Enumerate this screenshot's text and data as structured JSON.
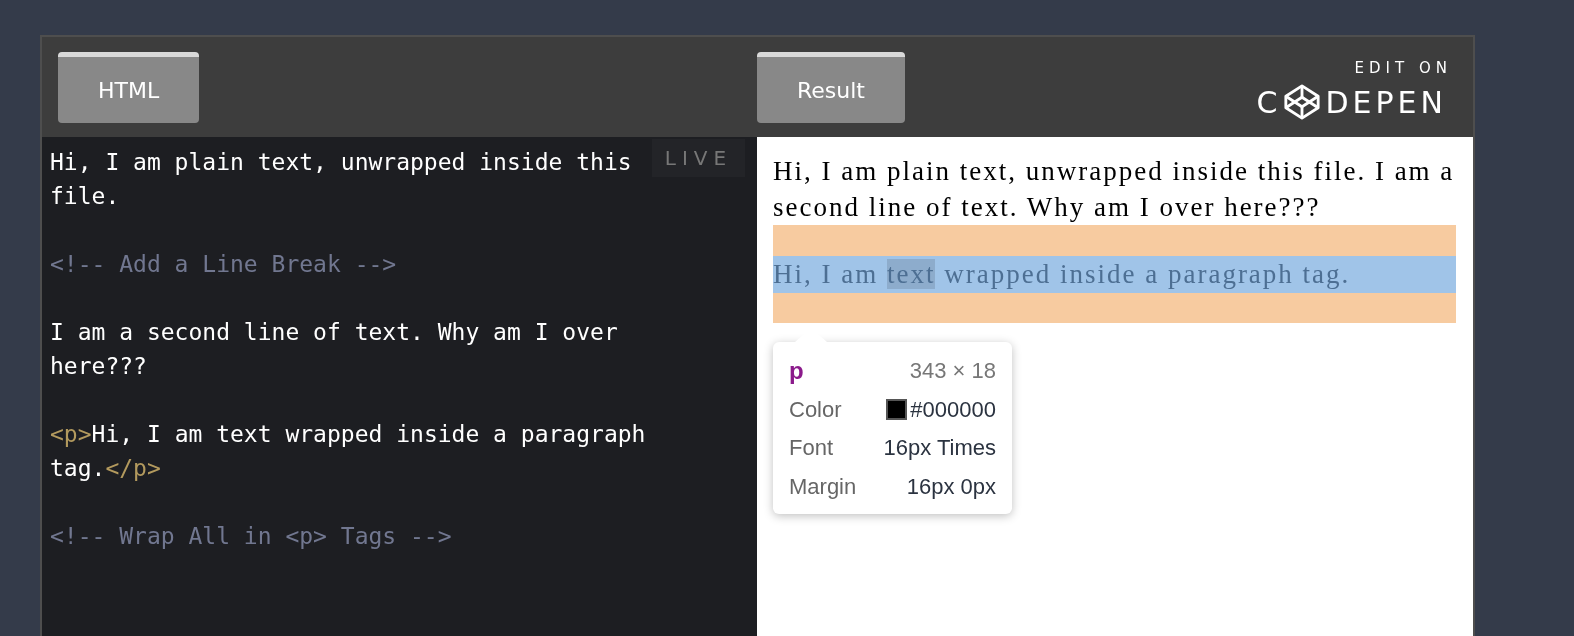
{
  "header": {
    "tabs": [
      {
        "label": "HTML"
      },
      {
        "label": "Result"
      }
    ],
    "logo": {
      "top": "EDIT ON",
      "lead": "C",
      "tail": "DEPEN"
    }
  },
  "editor": {
    "badge": "LIVE",
    "lines": [
      {
        "kind": "code",
        "segments": [
          {
            "kind": "text",
            "text": "Hi, I am plain text, unwrapped inside this"
          }
        ]
      },
      {
        "kind": "code",
        "segments": [
          {
            "kind": "text",
            "text": "file."
          }
        ]
      },
      {
        "kind": "blank"
      },
      {
        "kind": "code",
        "segments": [
          {
            "kind": "comment",
            "text": "<!-- Add a Line Break -->"
          }
        ]
      },
      {
        "kind": "blank"
      },
      {
        "kind": "code",
        "segments": [
          {
            "kind": "text",
            "text": "I am a second line of text. Why am I over"
          }
        ]
      },
      {
        "kind": "code",
        "segments": [
          {
            "kind": "text",
            "text": "here???"
          }
        ]
      },
      {
        "kind": "blank"
      },
      {
        "kind": "code",
        "segments": [
          {
            "kind": "tag",
            "text": "<p>"
          },
          {
            "kind": "text",
            "text": "Hi, I am text wrapped inside a paragraph"
          }
        ]
      },
      {
        "kind": "code",
        "segments": [
          {
            "kind": "text",
            "text": "tag."
          },
          {
            "kind": "tag",
            "text": "</p>"
          }
        ]
      },
      {
        "kind": "blank"
      },
      {
        "kind": "code",
        "segments": [
          {
            "kind": "comment",
            "text": "<!-- Wrap All in <p> Tags -->"
          }
        ]
      }
    ]
  },
  "result": {
    "plain_text": "Hi, I am plain text, unwrapped inside this file. I am a second line of text. Why am I over here???",
    "paragraph": {
      "before": "Hi, I am ",
      "highlight": "text",
      "after": " wrapped inside a paragraph tag."
    },
    "tooltip": {
      "tag": "p",
      "size": "343 × 18",
      "rows": [
        {
          "label": "Color",
          "value": "#000000",
          "color": "#000000"
        },
        {
          "label": "Font",
          "value": "16px Times"
        },
        {
          "label": "Margin",
          "value": "16px 0px"
        }
      ]
    }
  }
}
